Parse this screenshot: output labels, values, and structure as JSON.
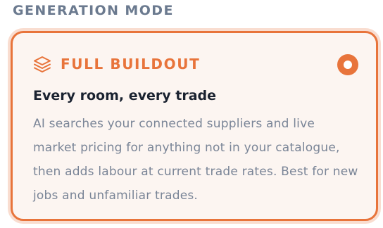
{
  "section": {
    "label": "GENERATION MODE"
  },
  "option": {
    "icon": "layers-icon",
    "title": "FULL BUILDOUT",
    "subtitle": "Every room, every trade",
    "description": "AI searches your connected suppliers and live market pricing for anything not in your catalogue, then adds labour at current trade rates. Best for new jobs and unfamiliar trades.",
    "selected": true
  },
  "colors": {
    "accent": "#e8743b",
    "card_background": "#fcf5f1",
    "title_text": "#1a2230",
    "muted_text": "#7a8597",
    "section_label": "#6b7a8f"
  }
}
